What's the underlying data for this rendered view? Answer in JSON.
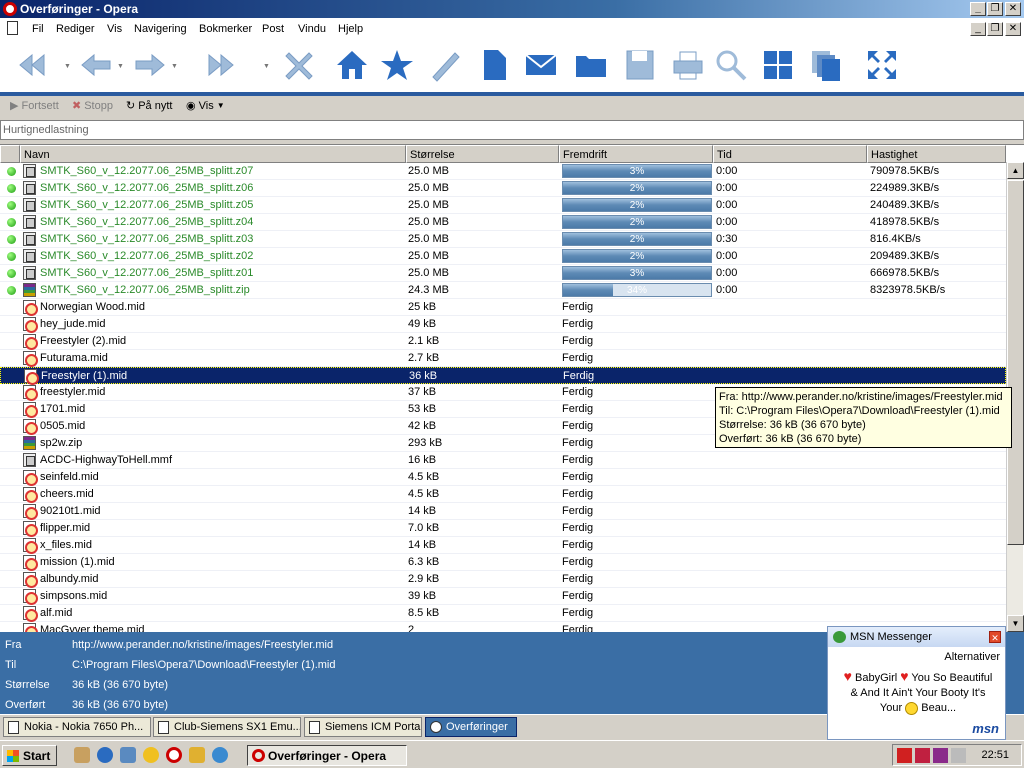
{
  "window": {
    "title": "Overføringer - Opera"
  },
  "menu": [
    "Fil",
    "Rediger",
    "Vis",
    "Navigering",
    "Bokmerker",
    "Post",
    "Vindu",
    "Hjelp"
  ],
  "actions": {
    "fortsett": "Fortsett",
    "stopp": "Stopp",
    "pa_nytt": "På nytt",
    "vis": "Vis"
  },
  "quick_download_placeholder": "Hurtignedlastning",
  "columns": {
    "name": "Navn",
    "size": "Størrelse",
    "progress": "Fremdrift",
    "time": "Tid",
    "speed": "Hastighet"
  },
  "transfers": [
    {
      "name": "SMTK_S60_v_12.2077.06_25MB_splitt.z07",
      "size": "25.0 MB",
      "progress_label": "3%",
      "progress": 0.03,
      "time": "0:00",
      "speed": "790978.5KB/s",
      "active": true,
      "type": "rar"
    },
    {
      "name": "SMTK_S60_v_12.2077.06_25MB_splitt.z06",
      "size": "25.0 MB",
      "progress_label": "2%",
      "progress": 0.02,
      "time": "0:00",
      "speed": "224989.3KB/s",
      "active": true,
      "type": "rar"
    },
    {
      "name": "SMTK_S60_v_12.2077.06_25MB_splitt.z05",
      "size": "25.0 MB",
      "progress_label": "2%",
      "progress": 0.02,
      "time": "0:00",
      "speed": "240489.3KB/s",
      "active": true,
      "type": "rar"
    },
    {
      "name": "SMTK_S60_v_12.2077.06_25MB_splitt.z04",
      "size": "25.0 MB",
      "progress_label": "2%",
      "progress": 0.02,
      "time": "0:00",
      "speed": "418978.5KB/s",
      "active": true,
      "type": "rar"
    },
    {
      "name": "SMTK_S60_v_12.2077.06_25MB_splitt.z03",
      "size": "25.0 MB",
      "progress_label": "2%",
      "progress": 0.02,
      "time": "0:30",
      "speed": "816.4KB/s",
      "active": true,
      "type": "rar"
    },
    {
      "name": "SMTK_S60_v_12.2077.06_25MB_splitt.z02",
      "size": "25.0 MB",
      "progress_label": "2%",
      "progress": 0.02,
      "time": "0:00",
      "speed": "209489.3KB/s",
      "active": true,
      "type": "rar"
    },
    {
      "name": "SMTK_S60_v_12.2077.06_25MB_splitt.z01",
      "size": "25.0 MB",
      "progress_label": "3%",
      "progress": 0.03,
      "time": "0:00",
      "speed": "666978.5KB/s",
      "active": true,
      "type": "rar"
    },
    {
      "name": "SMTK_S60_v_12.2077.06_25MB_splitt.zip",
      "size": "24.3 MB",
      "progress_label": "34%",
      "progress": 0.34,
      "time": "0:00",
      "speed": "8323978.5KB/s",
      "active": true,
      "type": "zip"
    },
    {
      "name": "Norwegian Wood.mid",
      "size": "25 kB",
      "status": "Ferdig",
      "type": "mid"
    },
    {
      "name": "hey_jude.mid",
      "size": "49 kB",
      "status": "Ferdig",
      "type": "mid"
    },
    {
      "name": "Freestyler (2).mid",
      "size": "2.1 kB",
      "status": "Ferdig",
      "type": "mid"
    },
    {
      "name": "Futurama.mid",
      "size": "2.7 kB",
      "status": "Ferdig",
      "type": "mid"
    },
    {
      "name": "Freestyler (1).mid",
      "size": "36 kB",
      "status": "Ferdig",
      "type": "mid",
      "selected": true
    },
    {
      "name": "freestyler.mid",
      "size": "37 kB",
      "status": "Ferdig",
      "type": "mid"
    },
    {
      "name": "1701.mid",
      "size": "53 kB",
      "status": "Ferdig",
      "type": "mid"
    },
    {
      "name": "0505.mid",
      "size": "42 kB",
      "status": "Ferdig",
      "type": "mid"
    },
    {
      "name": "sp2w.zip",
      "size": "293 kB",
      "status": "Ferdig",
      "type": "zip"
    },
    {
      "name": "ACDC-HighwayToHell.mmf",
      "size": "16 kB",
      "status": "Ferdig",
      "type": "rar"
    },
    {
      "name": "seinfeld.mid",
      "size": "4.5 kB",
      "status": "Ferdig",
      "type": "mid"
    },
    {
      "name": "cheers.mid",
      "size": "4.5 kB",
      "status": "Ferdig",
      "type": "mid"
    },
    {
      "name": "90210t1.mid",
      "size": "14 kB",
      "status": "Ferdig",
      "type": "mid"
    },
    {
      "name": "flipper.mid",
      "size": "7.0 kB",
      "status": "Ferdig",
      "type": "mid"
    },
    {
      "name": "x_files.mid",
      "size": "14 kB",
      "status": "Ferdig",
      "type": "mid"
    },
    {
      "name": "mission (1).mid",
      "size": "6.3 kB",
      "status": "Ferdig",
      "type": "mid"
    },
    {
      "name": "albundy.mid",
      "size": "2.9 kB",
      "status": "Ferdig",
      "type": "mid"
    },
    {
      "name": "simpsons.mid",
      "size": "39 kB",
      "status": "Ferdig",
      "type": "mid"
    },
    {
      "name": "alf.mid",
      "size": "8.5 kB",
      "status": "Ferdig",
      "type": "mid"
    },
    {
      "name": "MacGyver theme.mid",
      "size": "2",
      "status": "Ferdig",
      "type": "mid"
    }
  ],
  "tooltip": {
    "fra": "Fra: http://www.perander.no/kristine/images/Freestyler.mid",
    "til": "Til: C:\\Program Files\\Opera7\\Download\\Freestyler (1).mid",
    "storrelse": "Størrelse: 36 kB (36 670 byte)",
    "overfort": "Overført: 36 kB (36 670 byte)"
  },
  "info": {
    "fra_label": "Fra",
    "fra": "http://www.perander.no/kristine/images/Freestyler.mid",
    "til_label": "Til",
    "til": "C:\\Program Files\\Opera7\\Download\\Freestyler (1).mid",
    "storrelse_label": "Størrelse",
    "storrelse": "36 kB (36 670 byte)",
    "overfort_label": "Overført",
    "overfort": "36 kB (36 670 byte)"
  },
  "tabs": [
    {
      "label": "Nokia - Nokia 7650 Ph..."
    },
    {
      "label": "Club-Siemens SX1 Emu..."
    },
    {
      "label": "Siemens ICM Portal"
    },
    {
      "label": "Overføringer",
      "active": true
    }
  ],
  "msn": {
    "title": "MSN Messenger",
    "options": "Alternativer",
    "line1_name": "BabyGirl",
    "line1_text": "You So Beautiful",
    "line2": "& And It Ain't Your Booty It's",
    "line3_a": "Your",
    "line3_b": "Beau...",
    "logo": "msn"
  },
  "taskbar": {
    "start": "Start",
    "task": "Overføringer - Opera",
    "clock": "22:51"
  },
  "colors": {
    "accent": "#3a6ea5",
    "selection": "#0a246a",
    "active_name": "#2a8a2a"
  }
}
